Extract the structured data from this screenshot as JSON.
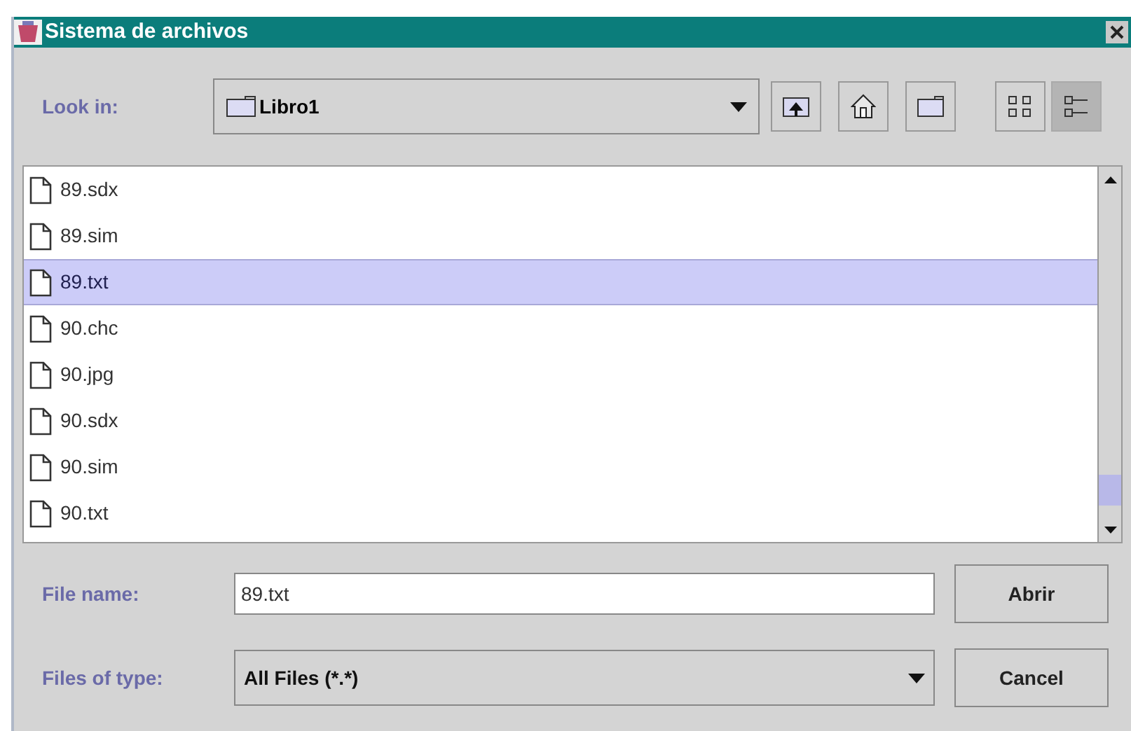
{
  "window": {
    "title": "Sistema de archivos"
  },
  "look_in": {
    "label": "Look in:",
    "value": "Libro1"
  },
  "toolbar": [
    {
      "kind": "up",
      "selected": false
    },
    {
      "kind": "home",
      "selected": false
    },
    {
      "kind": "newfolder",
      "selected": false
    },
    {
      "kind": "list",
      "selected": false
    },
    {
      "kind": "details",
      "selected": true
    }
  ],
  "files": [
    {
      "name": "89.sdx",
      "selected": false
    },
    {
      "name": "89.sim",
      "selected": false
    },
    {
      "name": "89.txt",
      "selected": true
    },
    {
      "name": "90.chc",
      "selected": false
    },
    {
      "name": "90.jpg",
      "selected": false
    },
    {
      "name": "90.sdx",
      "selected": false
    },
    {
      "name": "90.sim",
      "selected": false
    },
    {
      "name": "90.txt",
      "selected": false
    }
  ],
  "file_name": {
    "label": "File name:",
    "value": "89.txt"
  },
  "file_type": {
    "label": "Files of type:",
    "value": "All Files (*.*)"
  },
  "buttons": [
    "Abrir",
    "Cancel"
  ]
}
